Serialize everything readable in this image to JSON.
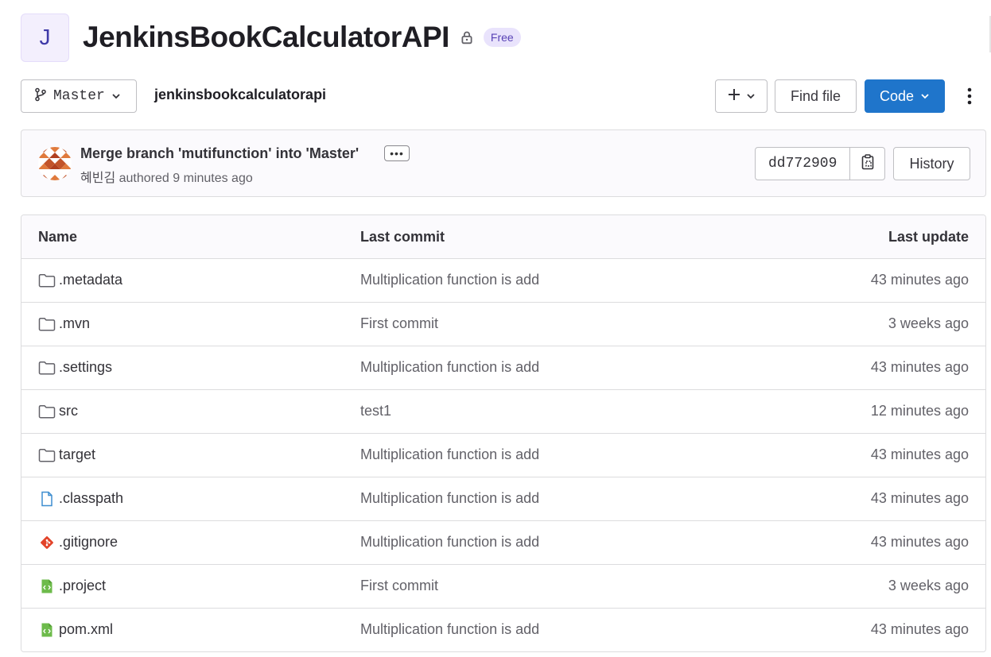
{
  "project": {
    "avatar_letter": "J",
    "title": "JenkinsBookCalculatorAPI",
    "badge": "Free",
    "visibility_icon": "lock-icon"
  },
  "toolbar": {
    "branch": "Master",
    "path": "jenkinsbookcalculatorapi",
    "add_icon": "plus-icon",
    "find_file_label": "Find file",
    "code_label": "Code"
  },
  "last_commit": {
    "title": "Merge branch 'mutifunction' into 'Master'",
    "author": "혜빈김",
    "authored_text": "authored 9 minutes ago",
    "sha": "dd772909",
    "history_label": "History"
  },
  "files": {
    "headers": {
      "name": "Name",
      "commit": "Last commit",
      "update": "Last update"
    },
    "rows": [
      {
        "icon": "folder-icon",
        "name": ".metadata",
        "commit": "Multiplication function is add",
        "update": "43 minutes ago"
      },
      {
        "icon": "folder-icon",
        "name": ".mvn",
        "commit": "First commit",
        "update": "3 weeks ago"
      },
      {
        "icon": "folder-icon",
        "name": ".settings",
        "commit": "Multiplication function is add",
        "update": "43 minutes ago"
      },
      {
        "icon": "folder-icon",
        "name": "src",
        "commit": "test1",
        "update": "12 minutes ago"
      },
      {
        "icon": "folder-icon",
        "name": "target",
        "commit": "Multiplication function is add",
        "update": "43 minutes ago"
      },
      {
        "icon": "file-icon",
        "name": ".classpath",
        "commit": "Multiplication function is add",
        "update": "43 minutes ago"
      },
      {
        "icon": "git-icon",
        "name": ".gitignore",
        "commit": "Multiplication function is add",
        "update": "43 minutes ago"
      },
      {
        "icon": "xml-file-icon",
        "name": ".project",
        "commit": "First commit",
        "update": "3 weeks ago"
      },
      {
        "icon": "xml-file-icon",
        "name": "pom.xml",
        "commit": "Multiplication function is add",
        "update": "43 minutes ago"
      }
    ]
  },
  "colors": {
    "primary": "#1f75cb",
    "badge_bg": "#e9e3fc",
    "badge_text": "#5943b6",
    "folder": "#626168",
    "file_blue": "#3e8ed0",
    "git_orange": "#e24329",
    "xml_green": "#6dbb4b"
  }
}
